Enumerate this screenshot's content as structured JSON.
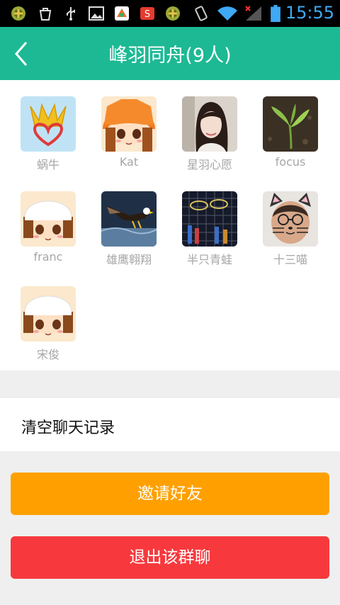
{
  "status_bar": {
    "time": "15:55",
    "icons": [
      "usb-debug-icon",
      "bag-icon",
      "usb-icon",
      "image-icon",
      "app-store-icon",
      "sohu-icon",
      "usb-debug-icon",
      "vibrate-icon",
      "wifi-icon",
      "signal-icon",
      "battery-icon"
    ]
  },
  "header": {
    "title": "峰羽同舟(9人)",
    "back_icon": "chevron-left-icon"
  },
  "members": [
    {
      "name": "蜗牛"
    },
    {
      "name": "Kat"
    },
    {
      "name": "星羽心愿"
    },
    {
      "name": "focus"
    },
    {
      "name": "franc"
    },
    {
      "name": "雄鹰翱翔"
    },
    {
      "name": "半只青蛙"
    },
    {
      "name": "十三喵"
    },
    {
      "name": "宋俊"
    }
  ],
  "actions": {
    "clear_history": "清空聊天记录",
    "invite": "邀请好友",
    "exit": "退出该群聊"
  },
  "colors": {
    "header": "#1db994",
    "invite": "#ffa000",
    "exit": "#f7393d",
    "time": "#3fa9f5"
  }
}
